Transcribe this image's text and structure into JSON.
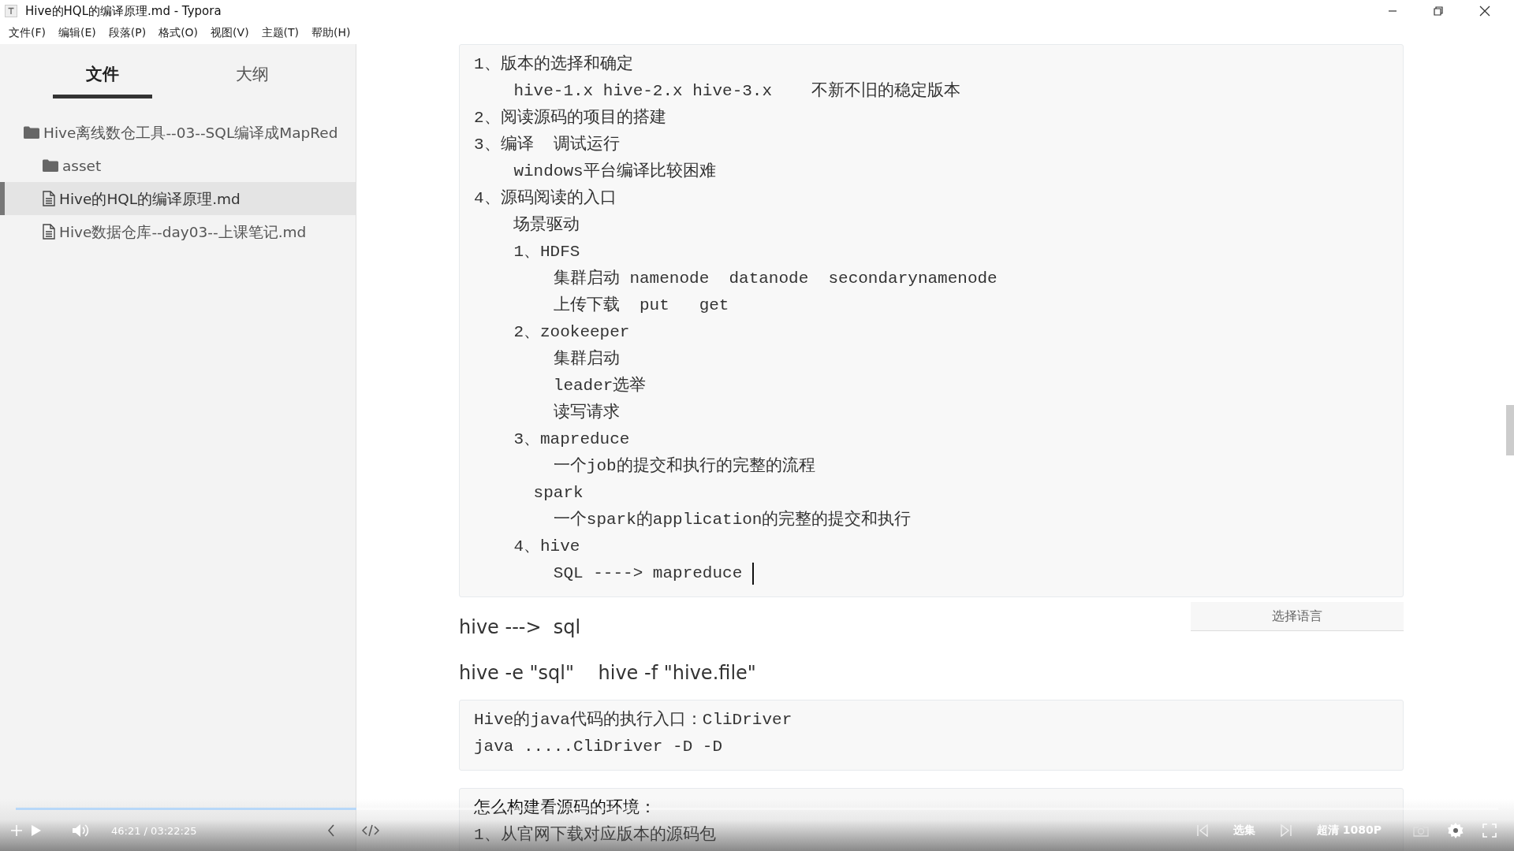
{
  "window": {
    "title": "Hive的HQL的编译原理.md - Typora"
  },
  "menu": [
    "文件(F)",
    "编辑(E)",
    "段落(P)",
    "格式(O)",
    "视图(V)",
    "主题(T)",
    "帮助(H)"
  ],
  "sidebar": {
    "tabs": [
      {
        "label": "文件",
        "selected": true
      },
      {
        "label": "大纲",
        "selected": false
      }
    ],
    "tree": [
      {
        "name": "Hive离线数仓工具--03--SQL编译成MapRed",
        "kind": "folder",
        "selected": false,
        "children": [
          {
            "name": "asset",
            "kind": "folder",
            "selected": false
          },
          {
            "name": "Hive的HQL的编译原理.md",
            "kind": "file",
            "selected": true
          },
          {
            "name": "Hive数据仓库--day03--上课笔记.md",
            "kind": "file",
            "selected": false
          }
        ]
      }
    ]
  },
  "editor": {
    "blocks": [
      {
        "kind": "code",
        "language_placeholder": "选择语言",
        "cursor": true,
        "lines": [
          "1、版本的选择和确定",
          "    hive-1.x hive-2.x hive-3.x    不新不旧的稳定版本",
          "2、阅读源码的项目的搭建",
          "3、编译  调试运行",
          "    windows平台编译比较困难",
          "4、源码阅读的入口",
          "    场景驱动",
          "    1、HDFS",
          "        集群启动 namenode  datanode  secondarynamenode",
          "        上传下载  put   get",
          "    2、zookeeper",
          "        集群启动",
          "        leader选举",
          "        读写请求",
          "    3、mapreduce",
          "        一个job的提交和执行的完整的流程",
          "      spark",
          "        一个spark的application的完整的提交和执行",
          "    4、hive",
          "        SQL ----> mapreduce "
        ]
      },
      {
        "kind": "paragraph",
        "text": "hive --->  sql"
      },
      {
        "kind": "paragraph",
        "text": "hive -e \"sql\"    hive -f \"hive.file\""
      },
      {
        "kind": "code",
        "cursor": false,
        "lines": [
          "Hive的java代码的执行入口：CliDriver",
          "java .....CliDriver -D -D"
        ]
      },
      {
        "kind": "code",
        "cursor": false,
        "lines": [
          "怎么构建看源码的环境：",
          "1、从官网下载对应版本的源码包"
        ]
      }
    ]
  },
  "player": {
    "progress": {
      "level": 0.23
    },
    "time": "46:21 / 03:22:25",
    "episodes": "选集",
    "quality": "超清 1080P"
  }
}
